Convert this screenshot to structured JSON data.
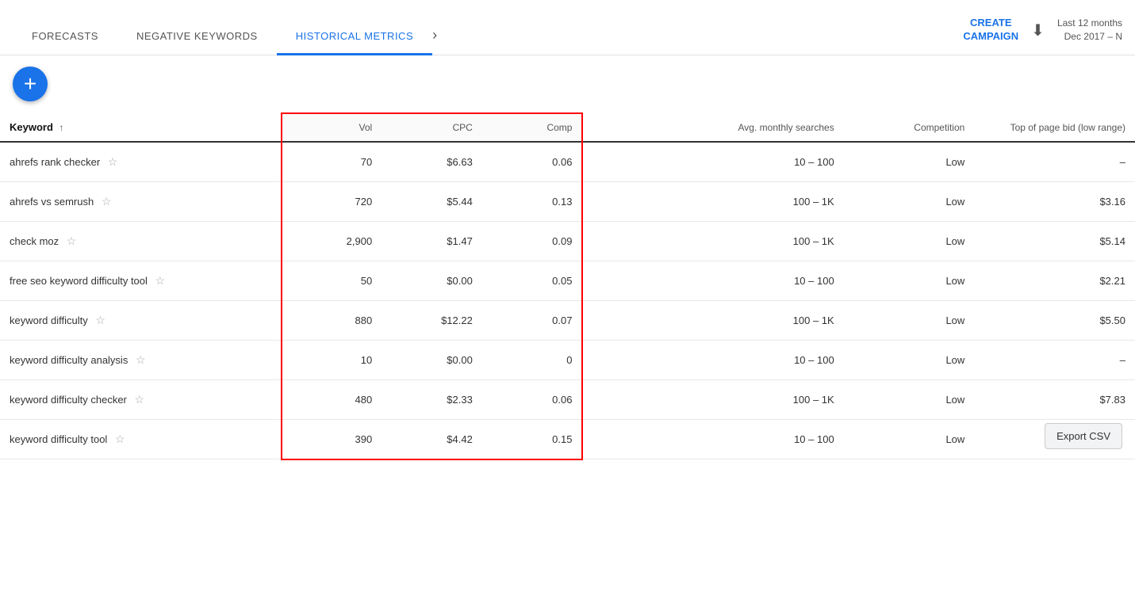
{
  "nav": {
    "tabs": [
      {
        "id": "forecasts",
        "label": "FORECASTS",
        "active": false
      },
      {
        "id": "negative-keywords",
        "label": "NEGATIVE KEYWORDS",
        "active": false
      },
      {
        "id": "historical-metrics",
        "label": "HISTORICAL METRICS",
        "active": true
      }
    ],
    "chevron": "›",
    "create_campaign": "CREATE\nCAMPAIGN",
    "download_icon": "⬇",
    "date_label": "Last 12 months",
    "date_range": "Dec 2017 – N"
  },
  "add_button_label": "+",
  "table": {
    "columns": {
      "keyword": "Keyword",
      "vol": "Vol",
      "cpc": "CPC",
      "comp": "Comp",
      "avg_monthly": "Avg. monthly searches",
      "competition": "Competition",
      "top_of_page_bid": "Top of page bid (low range)"
    },
    "rows": [
      {
        "keyword": "ahrefs rank checker",
        "vol": "70",
        "cpc": "$6.63",
        "comp": "0.06",
        "avg": "10 – 100",
        "competition": "Low",
        "top_bid": "–"
      },
      {
        "keyword": "ahrefs vs semrush",
        "vol": "720",
        "cpc": "$5.44",
        "comp": "0.13",
        "avg": "100 – 1K",
        "competition": "Low",
        "top_bid": "$3.16"
      },
      {
        "keyword": "check moz",
        "vol": "2,900",
        "cpc": "$1.47",
        "comp": "0.09",
        "avg": "100 – 1K",
        "competition": "Low",
        "top_bid": "$5.14"
      },
      {
        "keyword": "free seo keyword difficulty tool",
        "vol": "50",
        "cpc": "$0.00",
        "comp": "0.05",
        "avg": "10 – 100",
        "competition": "Low",
        "top_bid": "$2.21"
      },
      {
        "keyword": "keyword difficulty",
        "vol": "880",
        "cpc": "$12.22",
        "comp": "0.07",
        "avg": "100 – 1K",
        "competition": "Low",
        "top_bid": "$5.50"
      },
      {
        "keyword": "keyword difficulty analysis",
        "vol": "10",
        "cpc": "$0.00",
        "comp": "0",
        "avg": "10 – 100",
        "competition": "Low",
        "top_bid": "–"
      },
      {
        "keyword": "keyword difficulty checker",
        "vol": "480",
        "cpc": "$2.33",
        "comp": "0.06",
        "avg": "100 – 1K",
        "competition": "Low",
        "top_bid": "$7.83"
      },
      {
        "keyword": "keyword difficulty tool",
        "vol": "390",
        "cpc": "$4.42",
        "comp": "0.15",
        "avg": "10 – 100",
        "competition": "Low",
        "top_bid": ""
      }
    ],
    "export_csv_label": "Export CSV"
  }
}
